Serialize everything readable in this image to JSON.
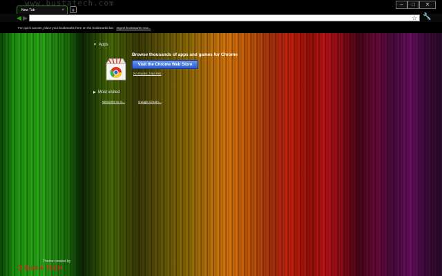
{
  "window": {
    "title_text": "www.bustatech.com",
    "controls": {
      "minimize": "–",
      "maximize": "□",
      "close": "✕"
    }
  },
  "tabs": [
    {
      "label": "New Tab",
      "close": "×"
    }
  ],
  "new_tab_label": "+",
  "toolbar": {
    "back_icon": "arrow-left-icon",
    "forward_icon": "arrow-right-icon",
    "reload_icon": "reload-icon",
    "omnibox_value": "",
    "star_icon": "star-icon",
    "wrench_icon": "wrench-icon"
  },
  "bookmark_bar": {
    "hint": "For quick access, place your bookmarks here on the bookmarks bar.",
    "import_link": "Import bookmarks now..."
  },
  "apps": {
    "heading": "Apps",
    "promo_title": "Browse thousands of apps and games for Chrome",
    "store_button": "Visit the Chrome Web Store",
    "no_thanks": "No thanks, hide this"
  },
  "most_visited": {
    "heading": "Most visited",
    "items": [
      "Welcome to G...",
      "Google Chrom..."
    ]
  },
  "theme": {
    "credit": "Theme created by",
    "brand": "Bust A TECH"
  },
  "colors": {
    "accent_green": "#2a9a18",
    "brand_red": "#e02020",
    "button_blue": "#2a5ad0"
  }
}
